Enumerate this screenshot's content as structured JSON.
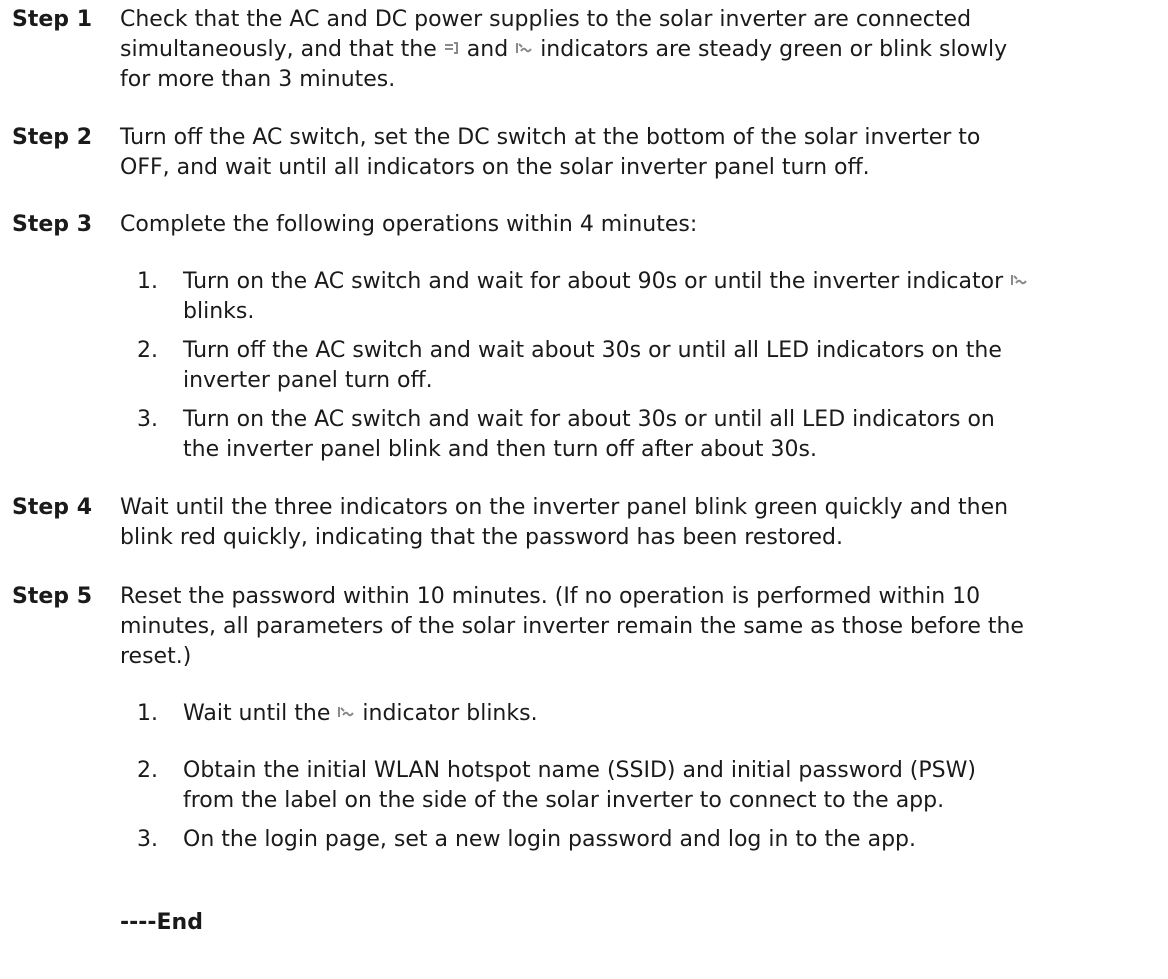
{
  "steps": [
    {
      "label": "Step 1",
      "segments": [
        "Check that the AC and DC power supplies to the solar inverter are connected",
        "simultaneously, and that the",
        "and",
        "indicators are steady green or blink slowly",
        "for more than 3 minutes."
      ],
      "icons": [
        "grid-indicator-icon",
        "inverter-indicator-icon"
      ]
    },
    {
      "label": "Step 2",
      "lines": [
        "Turn off the AC switch, set the DC switch at the bottom of the solar inverter to",
        "OFF, and wait until all indicators on the solar inverter panel turn off."
      ]
    },
    {
      "label": "Step 3",
      "text": "Complete the following operations within 4 minutes:",
      "substeps": [
        {
          "num": "1.",
          "lines": [
            "Turn on the AC switch and wait for about 90s or until the inverter indicator",
            "blinks."
          ],
          "icons": [
            "inverter-indicator-icon"
          ]
        },
        {
          "num": "2.",
          "lines": [
            "Turn off the AC switch and wait about 30s or until all LED indicators on the",
            "inverter panel turn off."
          ]
        },
        {
          "num": "3.",
          "lines": [
            "Turn on the AC switch and wait for about 30s or until all LED indicators on",
            "the inverter panel blink and then turn off after about 30s."
          ]
        }
      ]
    },
    {
      "label": "Step 4",
      "lines": [
        "Wait until the three indicators on the inverter panel blink green quickly and then",
        "blink red quickly, indicating that the password has been restored."
      ]
    },
    {
      "label": "Step 5",
      "lines": [
        "Reset the password within 10 minutes. (If no operation is performed within 10",
        "minutes, all parameters of the solar inverter remain the same as those before the",
        "reset.)"
      ],
      "substeps": [
        {
          "num": "1.",
          "segments": [
            "Wait until the",
            "indicator blinks."
          ],
          "icons": [
            "inverter-indicator-icon"
          ]
        },
        {
          "num": "2.",
          "lines": [
            "Obtain the initial WLAN hotspot name (SSID) and initial password (PSW)",
            "from the label on the side of the solar inverter to connect to the app."
          ]
        },
        {
          "num": "3.",
          "lines": [
            "On the login page, set a new login password and log in to the app."
          ]
        }
      ]
    }
  ],
  "end_mark": "----End",
  "colors": {
    "text": "#1a1a1a",
    "icon": "#8a8a8a"
  }
}
